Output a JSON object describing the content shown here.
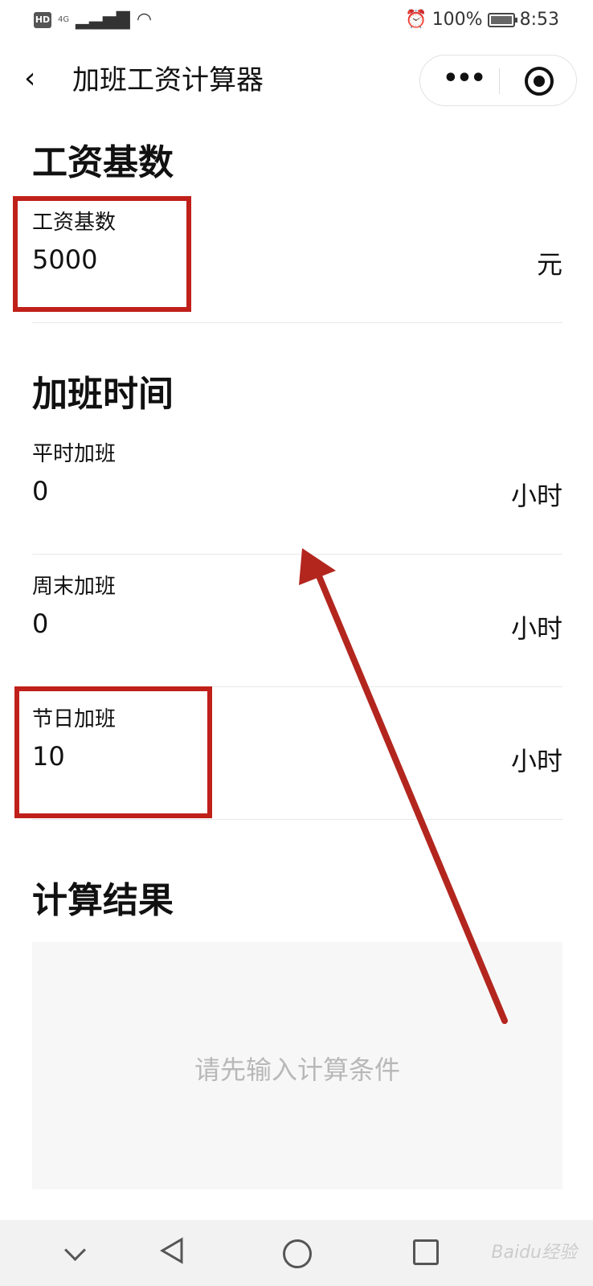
{
  "status_bar": {
    "left_badge": "HD",
    "network": "4G",
    "battery": "100%",
    "time": "8:53"
  },
  "nav": {
    "back_icon": "chevron-left-icon",
    "title": "加班工资计算器",
    "more_icon": "more-dots-icon",
    "close_icon": "target-icon"
  },
  "salary": {
    "section_title": "工资基数",
    "label": "工资基数",
    "value": "5000",
    "unit": "元"
  },
  "overtime": {
    "section_title": "加班时间",
    "fields": [
      {
        "label": "平时加班",
        "value": "0",
        "unit": "小时"
      },
      {
        "label": "周末加班",
        "value": "0",
        "unit": "小时"
      },
      {
        "label": "节日加班",
        "value": "10",
        "unit": "小时"
      }
    ]
  },
  "result": {
    "section_title": "计算结果",
    "placeholder": "请先输入计算条件"
  },
  "system_nav": {
    "watermark": "Baidu经验"
  },
  "annotation": {
    "box_color": "#c0201a",
    "arrow_color": "#b3261e"
  }
}
